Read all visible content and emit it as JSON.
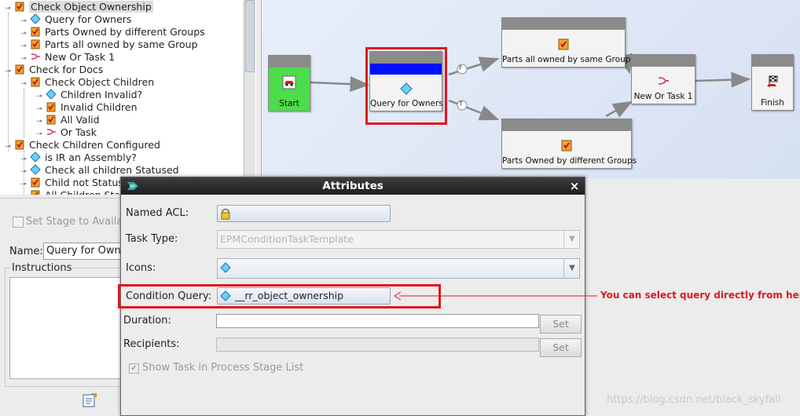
{
  "tree": {
    "items": [
      {
        "label": "Check Object Ownership",
        "icon": "task-icon"
      },
      {
        "label": "Query for Owners",
        "icon": "diamond-icon"
      },
      {
        "label": "Parts Owned by different Groups",
        "icon": "task-icon"
      },
      {
        "label": "Parts all owned by same Group",
        "icon": "task-icon"
      },
      {
        "label": "New Or Task 1",
        "icon": "or-icon"
      },
      {
        "label": "Check for Docs",
        "icon": "task-icon"
      },
      {
        "label": "Check Object Children",
        "icon": "task-icon"
      },
      {
        "label": "Children Invalid?",
        "icon": "diamond-icon"
      },
      {
        "label": "Invalid Children",
        "icon": "task-icon"
      },
      {
        "label": "All Valid",
        "icon": "task-icon"
      },
      {
        "label": "Or Task",
        "icon": "or-icon"
      },
      {
        "label": "Check Children Configured",
        "icon": "task-icon"
      },
      {
        "label": "is IR an Assembly?",
        "icon": "diamond-icon"
      },
      {
        "label": "Check all children Statused",
        "icon": "diamond-icon"
      },
      {
        "label": "Child not Statused",
        "icon": "task-icon"
      },
      {
        "label": "All Children Statused",
        "icon": "task-icon"
      }
    ]
  },
  "props": {
    "set_stage_label": "Set Stage to Available",
    "name_label": "Name:",
    "name_value": "Query for Owners",
    "instructions_label": "Instructions"
  },
  "canvas": {
    "nodes": {
      "start": "Start",
      "query": "Query for Owners",
      "same_group": "Parts all owned by same Group",
      "diff_groups": "Parts Owned by different Groups",
      "or_task": "New Or Task 1",
      "finish": "Finish"
    },
    "branch_false": "F",
    "branch_true": "T"
  },
  "dialog": {
    "title": "Attributes",
    "named_acl_label": "Named ACL:",
    "named_acl_value": "",
    "task_type_label": "Task Type:",
    "task_type_value": "EPMConditionTaskTemplate",
    "icons_label": "Icons:",
    "condition_query_label": "Condition Query:",
    "condition_query_value": "__rr_object_ownership",
    "duration_label": "Duration:",
    "recipients_label": "Recipients:",
    "set_label": "Set",
    "show_task_label": "Show Task in Process Stage List",
    "show_task_checked": true
  },
  "annotation": "You can select query directly from here",
  "watermark": "https://blog.csdn.net/black_skyfall",
  "colors": {
    "highlight": "#e0171f",
    "selected_node": "#0010ff",
    "start_node": "#4cdc4c"
  }
}
